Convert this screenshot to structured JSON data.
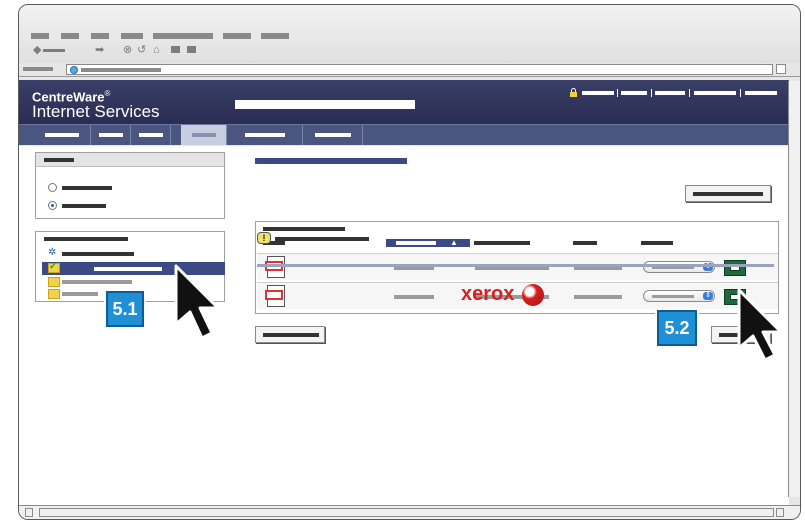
{
  "header": {
    "brand_name": "CentreWare",
    "brand_reg": "®",
    "brand_sub": "Internet Services"
  },
  "steps": {
    "step1": "5.1",
    "step2": "5.2"
  },
  "footer": {
    "logo_text": "xerox"
  },
  "icons": {
    "back": "arrow-left-icon",
    "forward": "arrow-right-icon",
    "stop": "stop-icon",
    "reload": "reload-icon",
    "home": "home-icon",
    "lock": "lock-icon",
    "hint": "info-icon"
  },
  "colors": {
    "header_bg": "#2a2d52",
    "badge": "#1f8fd6",
    "xerox_red": "#d7201f",
    "go_button": "#1f6a3a"
  }
}
